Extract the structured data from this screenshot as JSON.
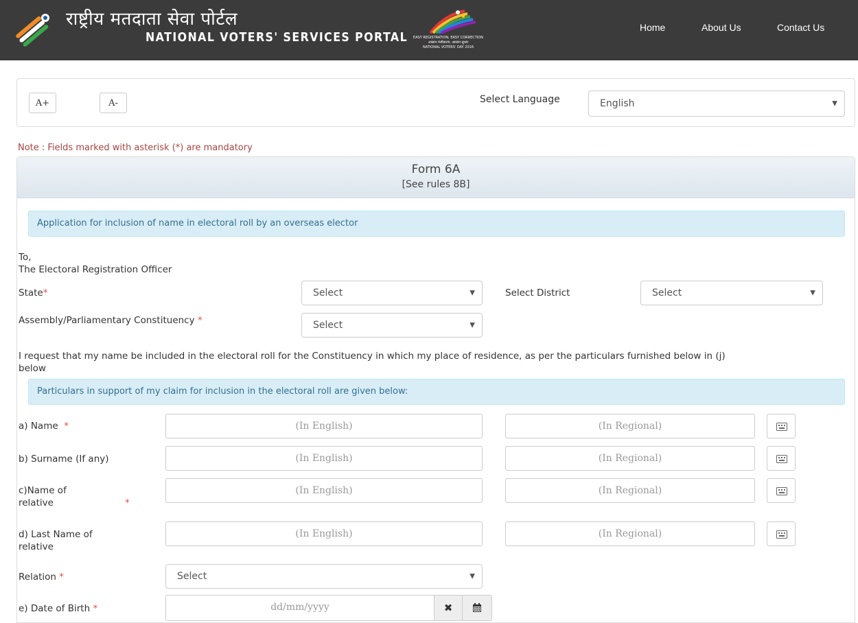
{
  "header": {
    "title_hindi": "राष्ट्रीय मतदाता सेवा पोर्टल",
    "title_english": "NATIONAL VOTERS' SERVICES PORTAL",
    "nvd_logo_lines": [
      "EASY REGISTRATION, EASY CORRECTION",
      "आसान पंजीकरण, आसान सुधार",
      "NATIONAL VOTERS' DAY 2016"
    ],
    "nav": [
      "Home",
      "About Us",
      "Contact Us"
    ]
  },
  "toolbar": {
    "font_increase": "A+",
    "font_decrease": "A-",
    "language_label": "Select Language",
    "language_value": "English"
  },
  "note": "Note : Fields marked with asterisk (*) are mandatory",
  "form": {
    "title": "Form 6A",
    "subtitle": "[See rules 8B]",
    "intro_bar": "Application for inclusion of name in electoral roll by an overseas elector",
    "to": "To,",
    "officer": "The Electoral Registration Officer",
    "state_label": "State",
    "state_value": "Select",
    "district_label": "Select District",
    "district_value": "Select",
    "constituency_label": "Assembly/Parliamentary Constituency",
    "constituency_value": "Select",
    "request_line1": "I request that my name be included in the electoral roll for the Constituency in which my place of residence, as per the particulars furnished below in (j)",
    "request_line2": "below",
    "particulars_bar": "Particulars in support of my claim for inclusion in the electoral roll are given below:",
    "name_label": "a) Name",
    "surname_label": "b) Surname (If any)",
    "relative_label_1": "c)Name of",
    "relative_label_2": "relative",
    "last_relative_label_1": "d) Last Name of",
    "last_relative_label_2": "relative",
    "english_placeholder": "(In English)",
    "regional_placeholder": "(In Regional)",
    "relation_label": "Relation",
    "relation_value": "Select",
    "dob_label": "e) Date of Birth",
    "dob_placeholder": "dd/mm/yyyy",
    "required_mark": "*"
  },
  "icons": {
    "clear": "close-icon",
    "calendar": "calendar-icon",
    "keyboard": "keyboard-icon"
  }
}
